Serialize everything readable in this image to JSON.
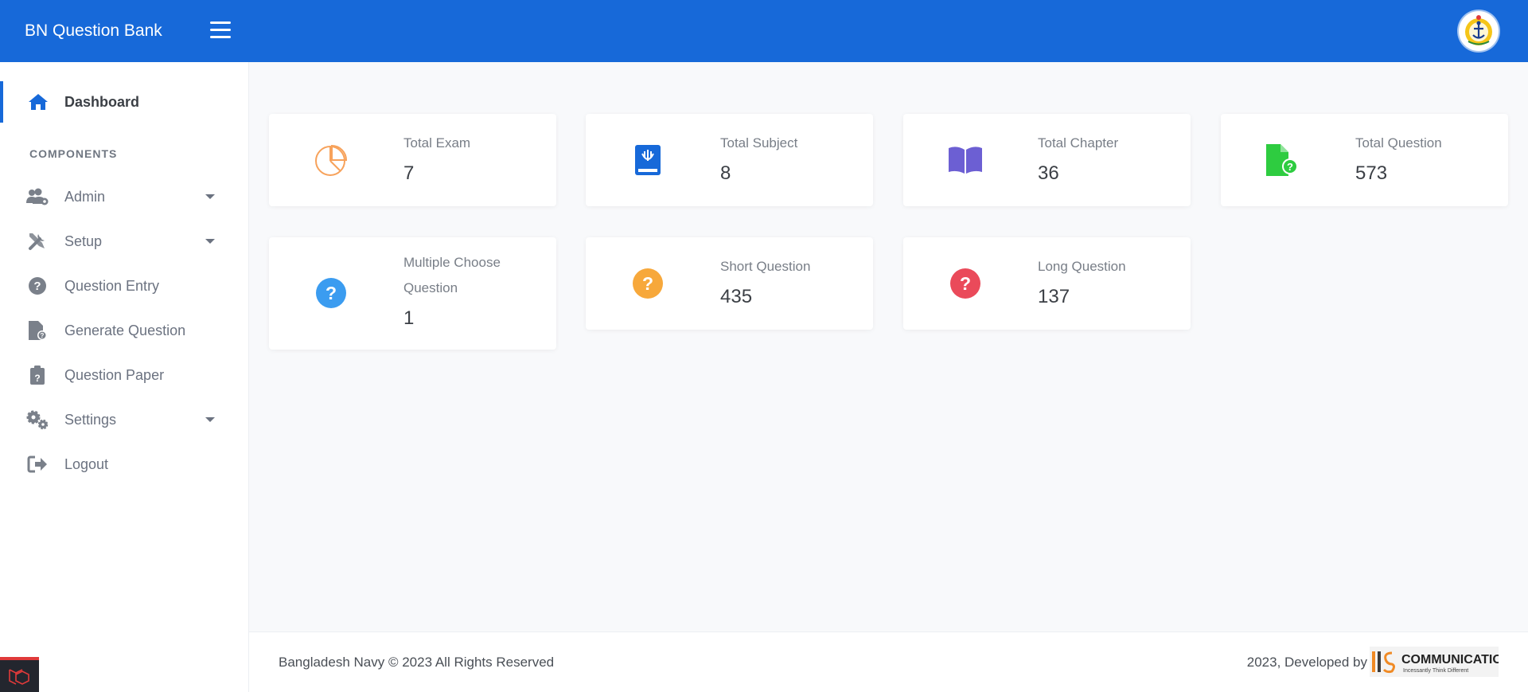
{
  "app": {
    "title": "BN Question Bank"
  },
  "sidebar": {
    "section_title": "COMPONENTS",
    "items": [
      {
        "label": "Dashboard",
        "icon": "home-icon",
        "active": true
      },
      {
        "label": "Admin",
        "icon": "users-cog-icon",
        "has_dropdown": true
      },
      {
        "label": "Setup",
        "icon": "tools-icon",
        "has_dropdown": true
      },
      {
        "label": "Question Entry",
        "icon": "question-circle-icon"
      },
      {
        "label": "Generate Question",
        "icon": "file-question-icon"
      },
      {
        "label": "Question Paper",
        "icon": "clipboard-question-icon"
      },
      {
        "label": "Settings",
        "icon": "cogs-icon",
        "has_dropdown": true
      },
      {
        "label": "Logout",
        "icon": "logout-icon"
      }
    ]
  },
  "cards": [
    {
      "title": "Total Exam",
      "value": "7",
      "icon": "pie-chart-icon",
      "color": "#f7a25b"
    },
    {
      "title": "Total Subject",
      "value": "8",
      "icon": "book-icon",
      "color": "#1769d9"
    },
    {
      "title": "Total Chapter",
      "value": "36",
      "icon": "open-book-icon",
      "color": "#6c5fd3"
    },
    {
      "title": "Total Question",
      "value": "573",
      "icon": "file-question-icon",
      "color": "#2ecc40"
    },
    {
      "title": "Multiple Choose Question",
      "value": "1",
      "icon": "question-circle-icon",
      "color": "#3b9cf0"
    },
    {
      "title": "Short Question",
      "value": "435",
      "icon": "question-circle-icon",
      "color": "#f7a83b"
    },
    {
      "title": "Long Question",
      "value": "137",
      "icon": "question-circle-icon",
      "color": "#ea4a5a"
    }
  ],
  "footer": {
    "copyright": "Bangladesh Navy © 2023 All Rights Reserved",
    "developed_by": "2023, Developed by",
    "company_name": "COMMUNICATIONS",
    "company_tagline": "Incessantly Think Different"
  },
  "colors": {
    "primary": "#1769d9",
    "background": "#f8f9fb"
  }
}
